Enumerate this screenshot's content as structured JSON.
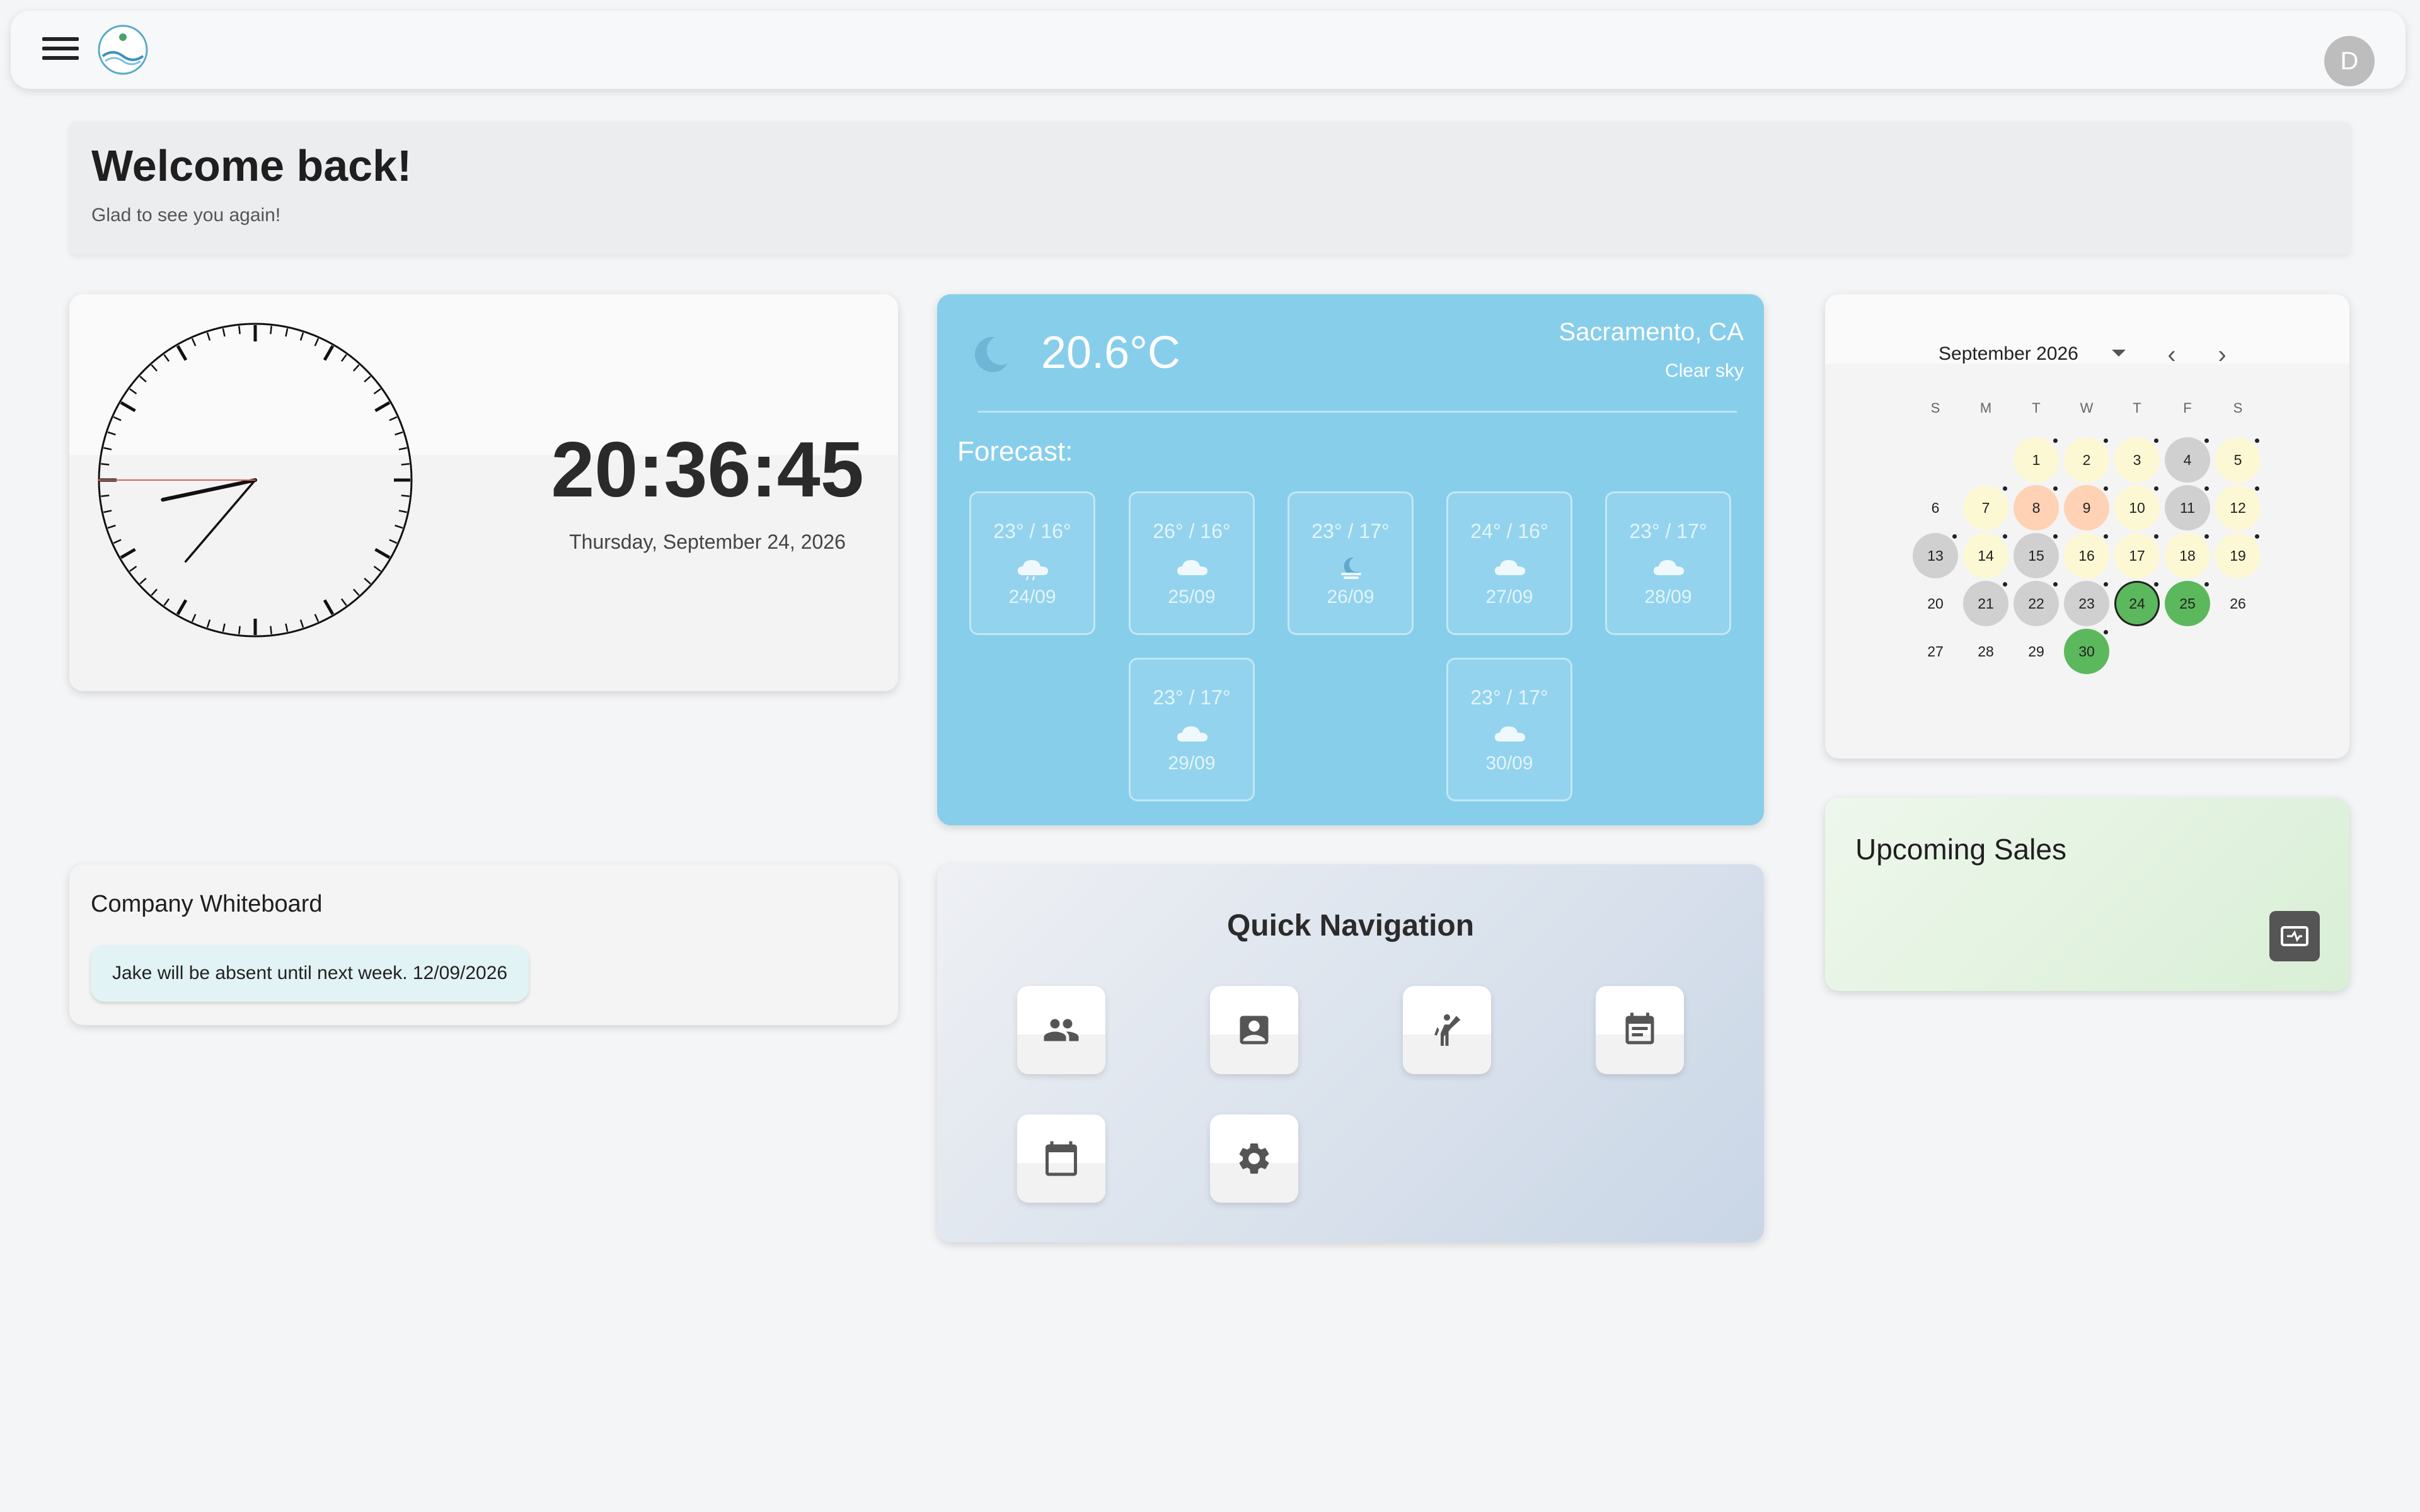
{
  "appbar": {
    "menu_icon": "hamburger-menu-icon",
    "logo_icon": "company-logo",
    "avatar_initial": "D"
  },
  "welcome": {
    "title": "Welcome back!",
    "subtitle": "Glad to see you again!"
  },
  "clock": {
    "time": "20:36:45",
    "date": "Thursday, September 24, 2026"
  },
  "weather": {
    "icon": "moon-icon",
    "temperature": "20.6°C",
    "city": "Sacramento, CA",
    "condition": "Clear sky",
    "forecast_label": "Forecast:",
    "forecast": [
      {
        "temp": "23° / 16°",
        "date": "24/09",
        "icon": "rain-cloud-icon"
      },
      {
        "temp": "26° / 16°",
        "date": "25/09",
        "icon": "cloud-icon"
      },
      {
        "temp": "23° / 17°",
        "date": "26/09",
        "icon": "moon-cloud-icon"
      },
      {
        "temp": "24° / 16°",
        "date": "27/09",
        "icon": "cloud-icon"
      },
      {
        "temp": "23° / 17°",
        "date": "28/09",
        "icon": "cloud-icon"
      },
      {
        "temp": "23° / 17°",
        "date": "29/09",
        "icon": "cloud-icon"
      },
      {
        "temp": "23° / 17°",
        "date": "30/09",
        "icon": "cloud-icon"
      }
    ]
  },
  "calendar": {
    "month_label": "September 2026",
    "weekdays": [
      "S",
      "M",
      "T",
      "W",
      "T",
      "F",
      "S"
    ],
    "days": [
      "1",
      "2",
      "3",
      "4",
      "5",
      "6",
      "7",
      "8",
      "9",
      "10",
      "11",
      "12",
      "13",
      "14",
      "15",
      "16",
      "17",
      "18",
      "19",
      "20",
      "21",
      "22",
      "23",
      "24",
      "25",
      "26",
      "27",
      "28",
      "29",
      "30"
    ],
    "colors": {
      "yellow": "#fdf8d4",
      "orange": "#ffd2b5",
      "gray": "#d0d0d0",
      "green": "#5cb85c"
    }
  },
  "sales": {
    "title": "Upcoming Sales",
    "button_icon": "sales-ticket-icon"
  },
  "whiteboard": {
    "title": "Company Whiteboard",
    "note": "Jake will be absent until next week. 12/09/2026"
  },
  "navigation": {
    "title": "Quick Navigation",
    "items": [
      "people-icon",
      "contact-card-icon",
      "person-raising-hand-icon",
      "event-note-icon",
      "calendar-icon",
      "settings-gear-icon"
    ]
  }
}
